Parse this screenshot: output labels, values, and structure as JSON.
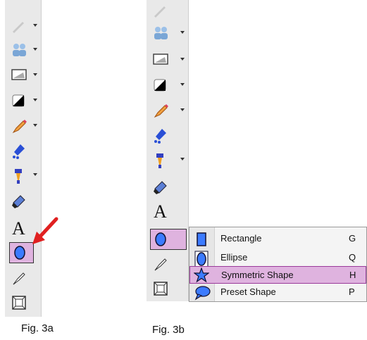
{
  "figure_a": {
    "caption": "Fig. 3a",
    "tools": [
      {
        "name": "pen-tool-icon"
      },
      {
        "name": "people-tool-icon"
      },
      {
        "name": "image-tool-icon"
      },
      {
        "name": "fill-tool-icon"
      },
      {
        "name": "pencil-tool-icon"
      },
      {
        "name": "brush-tool-icon"
      },
      {
        "name": "stamp-tool-icon"
      },
      {
        "name": "eraser-tool-icon"
      },
      {
        "name": "text-tool-icon",
        "glyph": "A"
      },
      {
        "name": "ellipse-tool-icon",
        "active": true
      },
      {
        "name": "pen-nib-tool-icon"
      },
      {
        "name": "frame-tool-icon"
      }
    ],
    "pointer": "red-arrow-icon"
  },
  "figure_b": {
    "caption": "Fig. 3b",
    "text_glyph": "A",
    "menu": {
      "items": [
        {
          "label": "Rectangle",
          "key": "G",
          "icon": "rectangle-icon"
        },
        {
          "label": "Ellipse",
          "key": "Q",
          "icon": "ellipse-icon"
        },
        {
          "label": "Symmetric Shape",
          "key": "H",
          "icon": "star-icon",
          "highlighted": true
        },
        {
          "label": "Preset Shape",
          "key": "P",
          "icon": "speech-bubble-icon"
        }
      ]
    }
  },
  "colors": {
    "toolbar": "#e9e9e9",
    "highlight": "#dfb3df",
    "highlight_border": "#9a3a9a",
    "ellipse_fill": "#3c7bff",
    "pointer": "#e02020"
  }
}
